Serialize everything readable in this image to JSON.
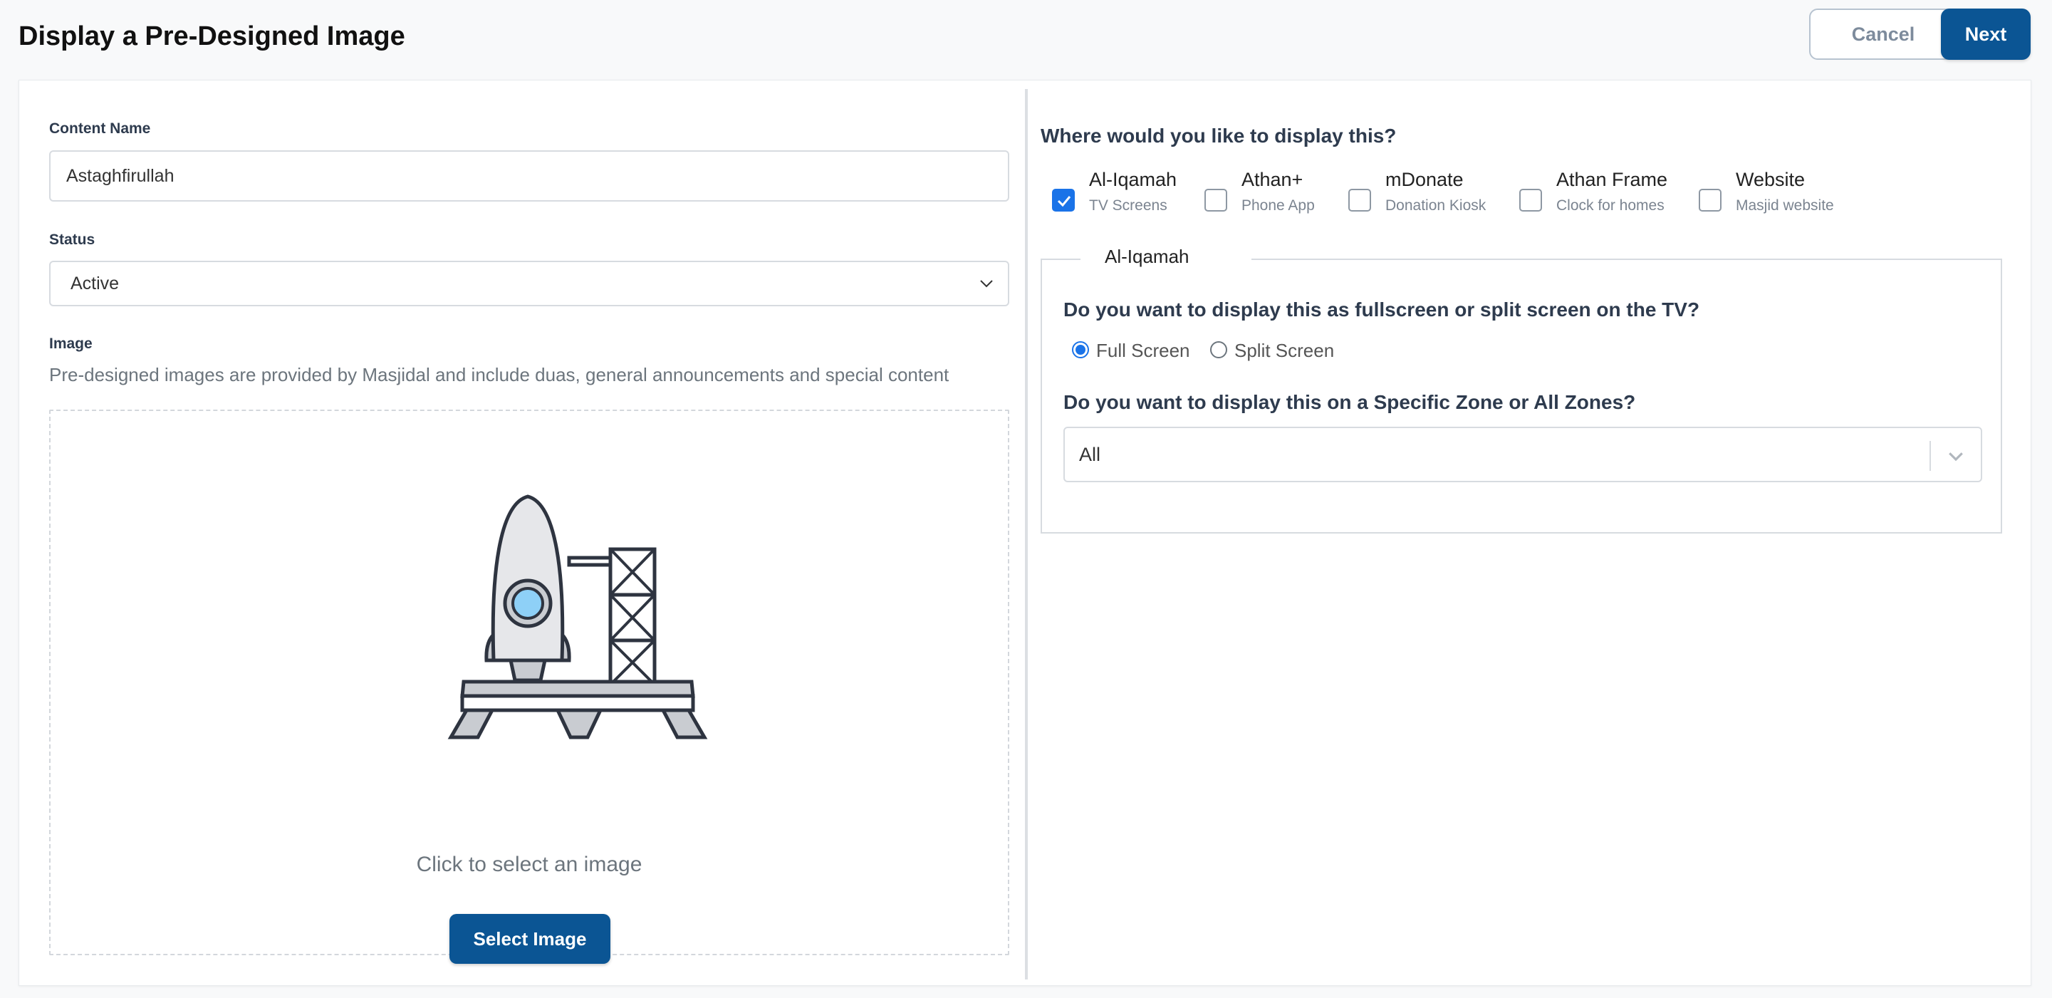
{
  "header": {
    "title": "Display a Pre-Designed Image",
    "cancel_label": "Cancel",
    "next_label": "Next"
  },
  "form": {
    "content_name_label": "Content Name",
    "content_name_value": "Astaghfirullah",
    "status_label": "Status",
    "status_value": "Active",
    "image_label": "Image",
    "image_help": "Pre-designed images are provided by Masjidal and include duas, general announcements and special content",
    "dropzone_text": "Click to select an image",
    "select_image_label": "Select Image"
  },
  "display": {
    "question": "Where would you like to display this?",
    "platforms": [
      {
        "title": "Al-Iqamah",
        "subtitle": "TV Screens",
        "checked": true
      },
      {
        "title": "Athan+",
        "subtitle": "Phone App",
        "checked": false
      },
      {
        "title": "mDonate",
        "subtitle": "Donation Kiosk",
        "checked": false
      },
      {
        "title": "Athan Frame",
        "subtitle": "Clock for homes",
        "checked": false
      },
      {
        "title": "Website",
        "subtitle": "Masjid website",
        "checked": false
      }
    ]
  },
  "aliqamah": {
    "legend": "Al-Iqamah",
    "screen_question": "Do you want to display this as fullscreen or split screen on the TV?",
    "full_screen_label": "Full Screen",
    "split_screen_label": "Split Screen",
    "selected_mode": "Full Screen",
    "zone_question": "Do you want to display this on a Specific Zone or All Zones?",
    "zone_value": "All"
  },
  "colors": {
    "primary": "#0b5594",
    "checkbox_checked": "#1a73e8"
  }
}
